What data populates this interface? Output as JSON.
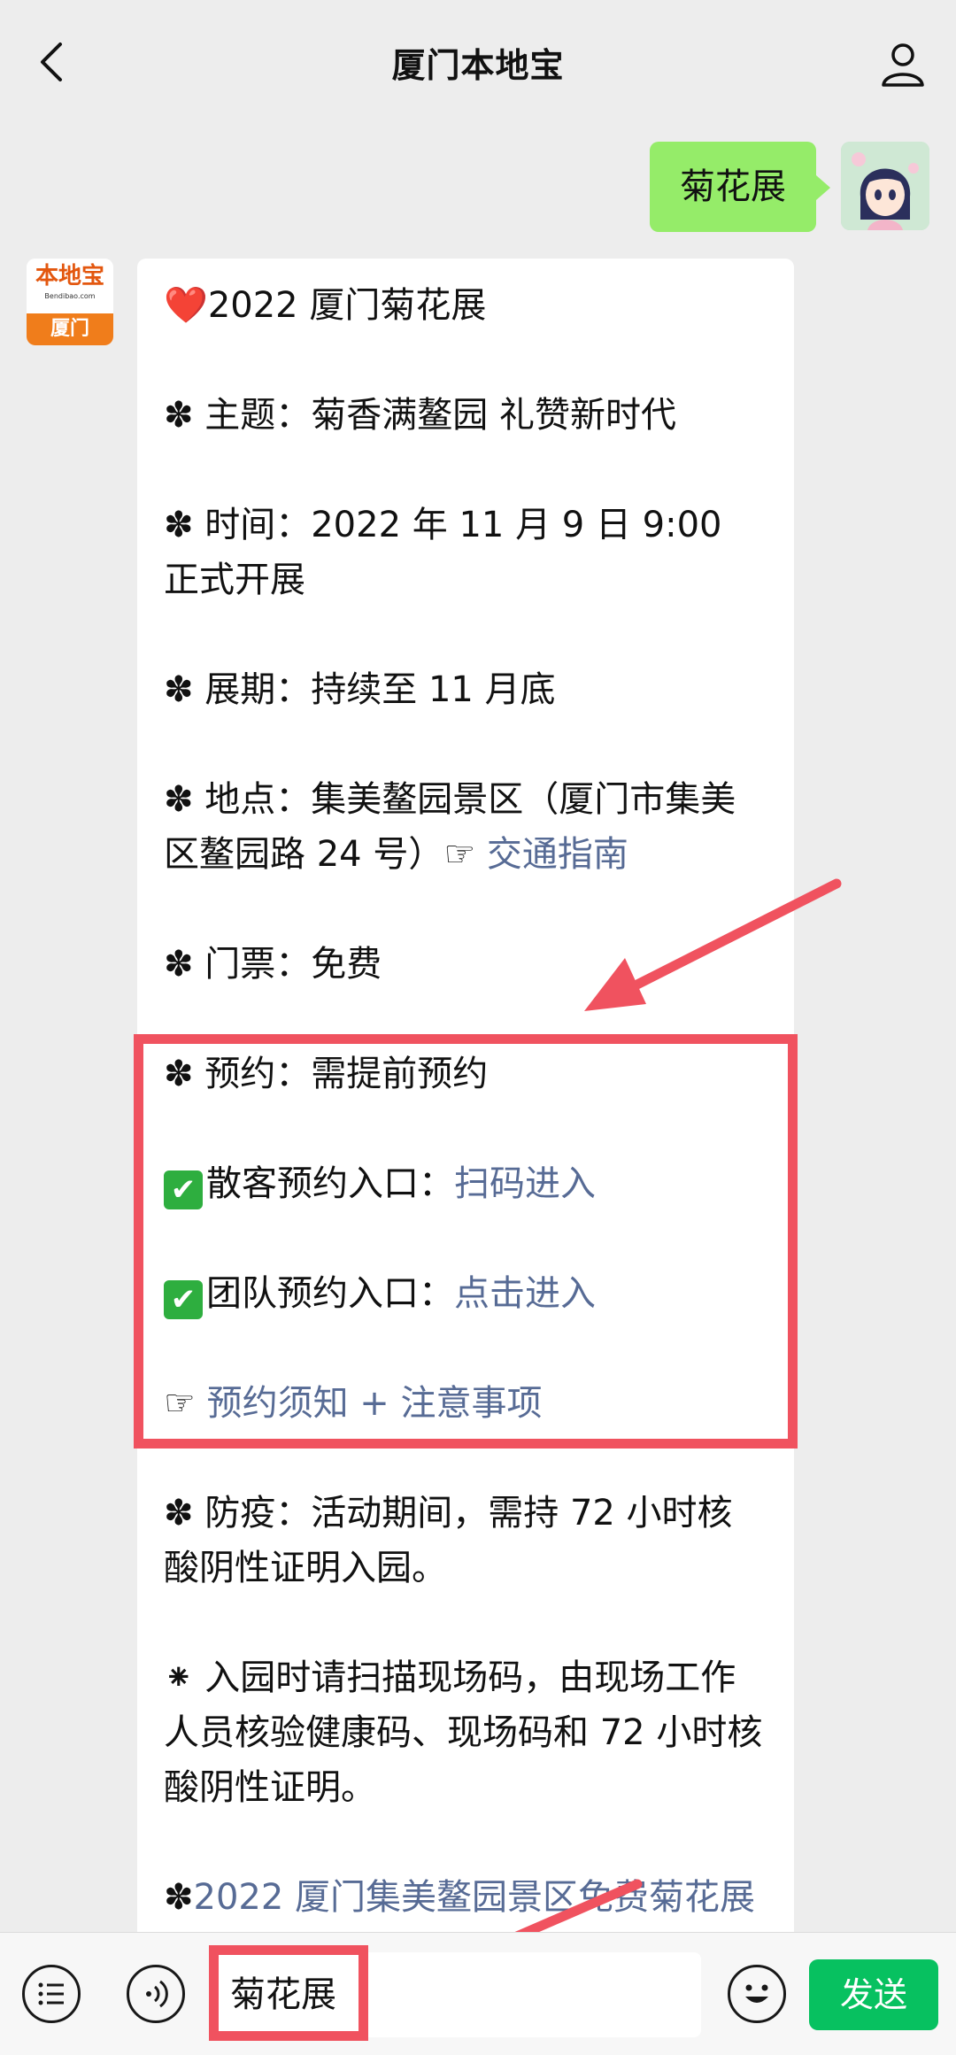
{
  "header": {
    "title": "厦门本地宝",
    "back_icon": "chevron-left-icon",
    "profile_icon": "person-icon"
  },
  "outgoing": {
    "text": "菊花展",
    "bubble_color": "#95ec69"
  },
  "bot": {
    "avatar_top": "本地宝",
    "avatar_sub": "Bendibao.com",
    "avatar_bottom": "厦门",
    "brand_color": "#f07d1b"
  },
  "message": {
    "title_emoji": "❤️",
    "title": "2022 厦门菊花展",
    "bullet": "✽",
    "theme": "主题：菊香满鳌园 礼赞新时代",
    "time": "时间：2022 年 11 月 9 日 9:00 正式开展",
    "period": "展期：持续至 11 月底",
    "location": "地点：集美鳌园景区（厦门市集美区鳌园路 24 号）",
    "pointer": "☞",
    "traffic_link": "交通指南",
    "ticket": "门票：免费",
    "reserve": "预约：需提前预约",
    "check": "✔",
    "individual_label": "散客预约入口：",
    "individual_link": "扫码进入",
    "group_label": "团队预约入口：",
    "group_link": "点击进入",
    "notice_link": "预约须知 + 注意事项",
    "epidemic": "防疫：活动期间，需持 72 小时核酸阴性证明入园。",
    "small_bullet": "⁕",
    "entry_note": "入园时请扫描现场码，由现场工作人员核验健康码、现场码和 72 小时核酸阴性证明。",
    "footer_link": "2022 厦门集美鳌园景区免费菊花展",
    "link_color": "#576b95"
  },
  "input_bar": {
    "menu_icon": "list-icon",
    "voice_icon": "voice-icon",
    "input_value": "菊花展",
    "emoji_icon": "smiley-icon",
    "send_label": "发送",
    "send_color": "#07c160"
  },
  "annotation_color": "#f0525f"
}
